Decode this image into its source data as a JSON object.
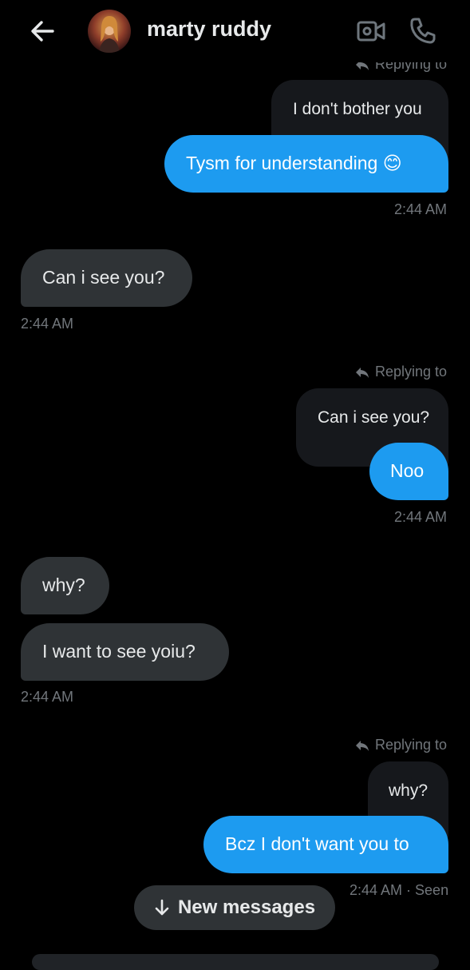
{
  "header": {
    "title": "marty ruddy",
    "back_icon": "arrow-left-icon",
    "video_icon": "video-camera-icon",
    "call_icon": "phone-icon"
  },
  "messages": {
    "top_reply_label": "Replying to",
    "ctx1": "I don't bother you",
    "sent1": "Tysm for understanding 😊",
    "time1": "2:44 AM",
    "recv1": "Can i see you?",
    "time2": "2:44 AM",
    "reply_label2": "Replying to",
    "ctx2": "Can i see you?",
    "sent2": "Noo",
    "time3": "2:44 AM",
    "recv2": "why?",
    "recv3": "I want to see yoiu?",
    "time4": "2:44 AM",
    "reply_label3": "Replying to",
    "ctx3": "why?",
    "sent3": "Bcz I don't want you to",
    "time5": "2:44 AM · Seen"
  },
  "new_messages": {
    "label": "New messages",
    "icon": "arrow-down-icon"
  },
  "colors": {
    "background": "#000000",
    "sent_bubble": "#1d9bf0",
    "received_bubble": "#2f3336",
    "context_bubble": "#16181c",
    "muted_text": "#71767b"
  }
}
